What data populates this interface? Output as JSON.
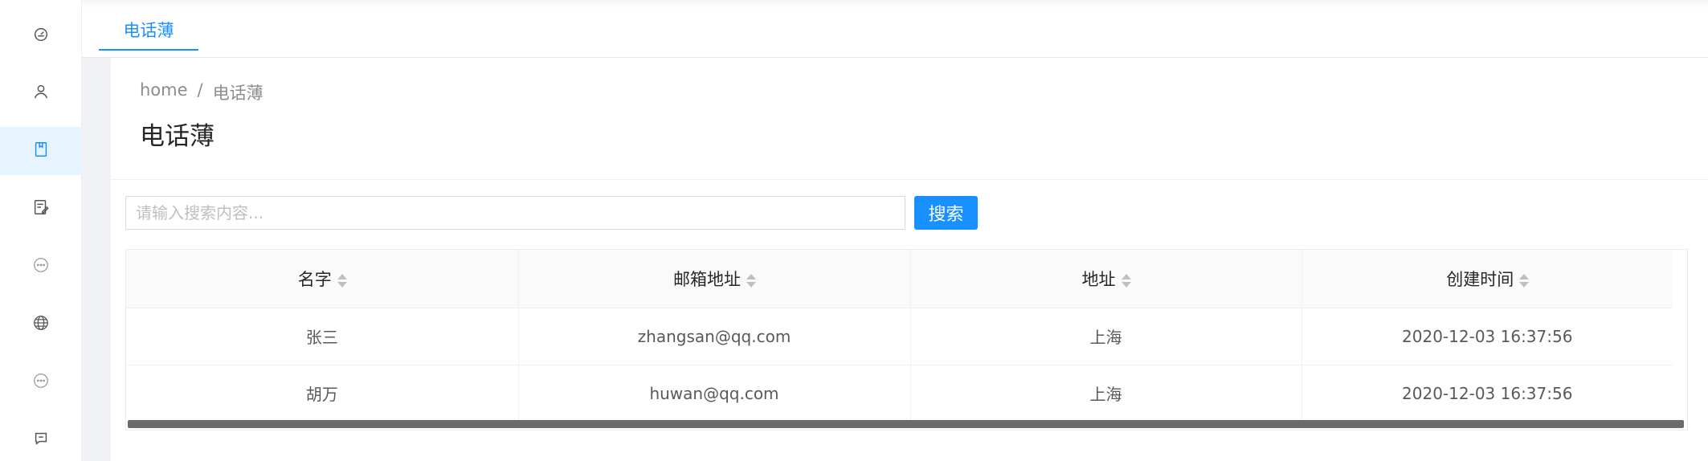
{
  "topbar": {
    "tab_label": "电话薄"
  },
  "breadcrumb": {
    "home": "home",
    "separator": "/",
    "current": "电话薄"
  },
  "page": {
    "title": "电话薄"
  },
  "search": {
    "placeholder": "请输入搜索内容...",
    "value": "",
    "button_label": "搜索"
  },
  "sidebar": {
    "items": [
      {
        "icon": "dashboard-icon",
        "active": false
      },
      {
        "icon": "user-icon",
        "active": false
      },
      {
        "icon": "book-icon",
        "active": true
      },
      {
        "icon": "edit-document-icon",
        "active": false
      },
      {
        "icon": "chat-bubble-icon",
        "active": false
      },
      {
        "icon": "globe-icon",
        "active": false
      },
      {
        "icon": "chat-bubble-icon",
        "active": false
      },
      {
        "icon": "message-icon",
        "active": false
      }
    ]
  },
  "table": {
    "columns": [
      "名字",
      "邮箱地址",
      "地址",
      "创建时间"
    ],
    "rows": [
      [
        "张三",
        "zhangsan@qq.com",
        "上海",
        "2020-12-03 16:37:56"
      ],
      [
        "胡万",
        "huwan@qq.com",
        "上海",
        "2020-12-03 16:37:56"
      ]
    ]
  },
  "colors": {
    "accent": "#1890ff",
    "active_bg": "#e6f4ff"
  }
}
